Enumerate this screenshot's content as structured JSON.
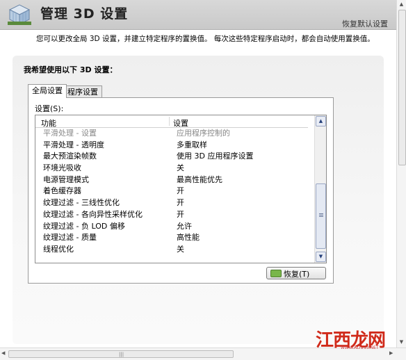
{
  "header": {
    "title": "管理 3D 设置",
    "restore_defaults_link": "恢复默认设置"
  },
  "description": "您可以更改全局 3D 设置，并建立特定程序的置换值。 每次这些特定程序启动时，都会自动使用置换值。",
  "panel": {
    "heading": "我希望使用以下 3D 设置：",
    "tabs": [
      {
        "label": "全局设置",
        "active": true
      },
      {
        "label": "程序设置",
        "active": false
      }
    ],
    "settings_label": "设置(S):",
    "columns": {
      "feature": "功能",
      "setting": "设置"
    },
    "rows": [
      {
        "feature": "平滑处理 - 设置",
        "value": "应用程序控制的",
        "dimmed": true
      },
      {
        "feature": "平滑处理 - 透明度",
        "value": "多重取样",
        "dimmed": false
      },
      {
        "feature": "最大预渲染帧数",
        "value": "使用 3D 应用程序设置",
        "dimmed": false
      },
      {
        "feature": "环境光吸收",
        "value": "关",
        "dimmed": false
      },
      {
        "feature": "电源管理模式",
        "value": "最高性能优先",
        "dimmed": false
      },
      {
        "feature": "着色缓存器",
        "value": "开",
        "dimmed": false
      },
      {
        "feature": "纹理过滤 - 三线性优化",
        "value": "开",
        "dimmed": false
      },
      {
        "feature": "纹理过滤 - 各向异性采样优化",
        "value": "开",
        "dimmed": false
      },
      {
        "feature": "纹理过滤 - 负 LOD 偏移",
        "value": "允许",
        "dimmed": false
      },
      {
        "feature": "纹理过滤 - 质量",
        "value": "高性能",
        "dimmed": false
      },
      {
        "feature": "线程优化",
        "value": "关",
        "dimmed": false
      }
    ],
    "restore_button": "恢复(T)"
  },
  "watermark": {
    "text": "江西龙网",
    "site": "WWW.ALT213.NET"
  },
  "colors": {
    "header_bg": "#cfcfcf",
    "panel_bg": "#f2f2f2",
    "restore_icon": "#79b64a",
    "watermark": "#d02a1a"
  }
}
